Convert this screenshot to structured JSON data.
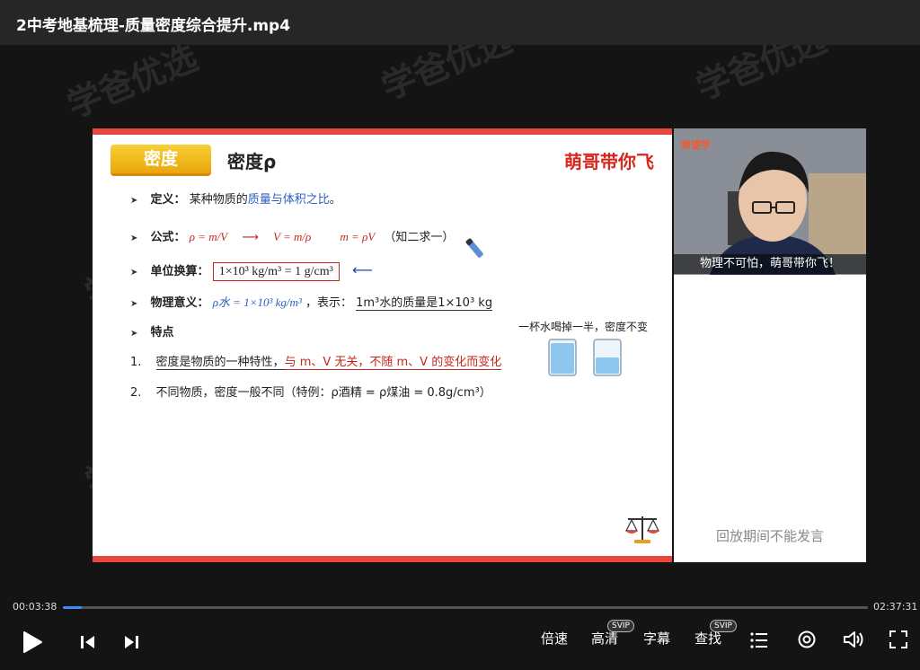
{
  "window": {
    "title": "2中考地基梳理-质量密度综合提升.mp4"
  },
  "slide": {
    "section_tag": "密度",
    "section_title": "密度ρ",
    "brand": "萌哥带你飞",
    "definition_label": "定义：",
    "definition_text": "某种物质的",
    "definition_highlight": "质量与体积之比",
    "definition_end": "。",
    "formula_label": "公式：",
    "formula_1": "ρ = m/V",
    "formula_arrow": "⟶",
    "formula_2": "V = m/ρ",
    "formula_3": "m = ρV",
    "formula_note": "（知二求一）",
    "unit_label": "单位换算：",
    "unit_value": "1×10³ kg/m³ = 1 g/cm³",
    "meaning_label": "物理意义：",
    "meaning_formula": "ρ水 = 1×10³ kg/m³",
    "meaning_sep": "，表示：",
    "meaning_text": "1m³水的质量是1×10³ kg",
    "features_label": "特点",
    "feature_1_num": "1.",
    "feature_1_text": "密度是物质的一种特性，",
    "feature_1_highlight": "与 m、V 无关，不随 m、V 的变化而变化",
    "feature_2_num": "2.",
    "feature_2_text": "不同物质，密度一般不同（特例：ρ酒精 = ρ煤油 = 0.8g/cm³）",
    "cup_note": "一杯水喝掉一半，密度不变",
    "scale_icon": "balance-scale-icon",
    "colors": {
      "accent_red": "#e8463c",
      "tag_yellow": "#f2b51f",
      "highlight_blue": "#2b5ec4"
    }
  },
  "webcam": {
    "logo": "希望学",
    "caption": "物理不可怕，萌哥带你飞！"
  },
  "chat": {
    "notice": "回放期间不能发言"
  },
  "player": {
    "current_time": "00:03:38",
    "total_time": "02:37:31",
    "progress": 0.023,
    "speed_label": "倍速",
    "quality_label": "高清",
    "quality_badge": "SVIP",
    "subtitle_label": "字幕",
    "search_label": "查找",
    "search_badge": "SVIP"
  },
  "watermark": {
    "text": "学爸优选"
  }
}
